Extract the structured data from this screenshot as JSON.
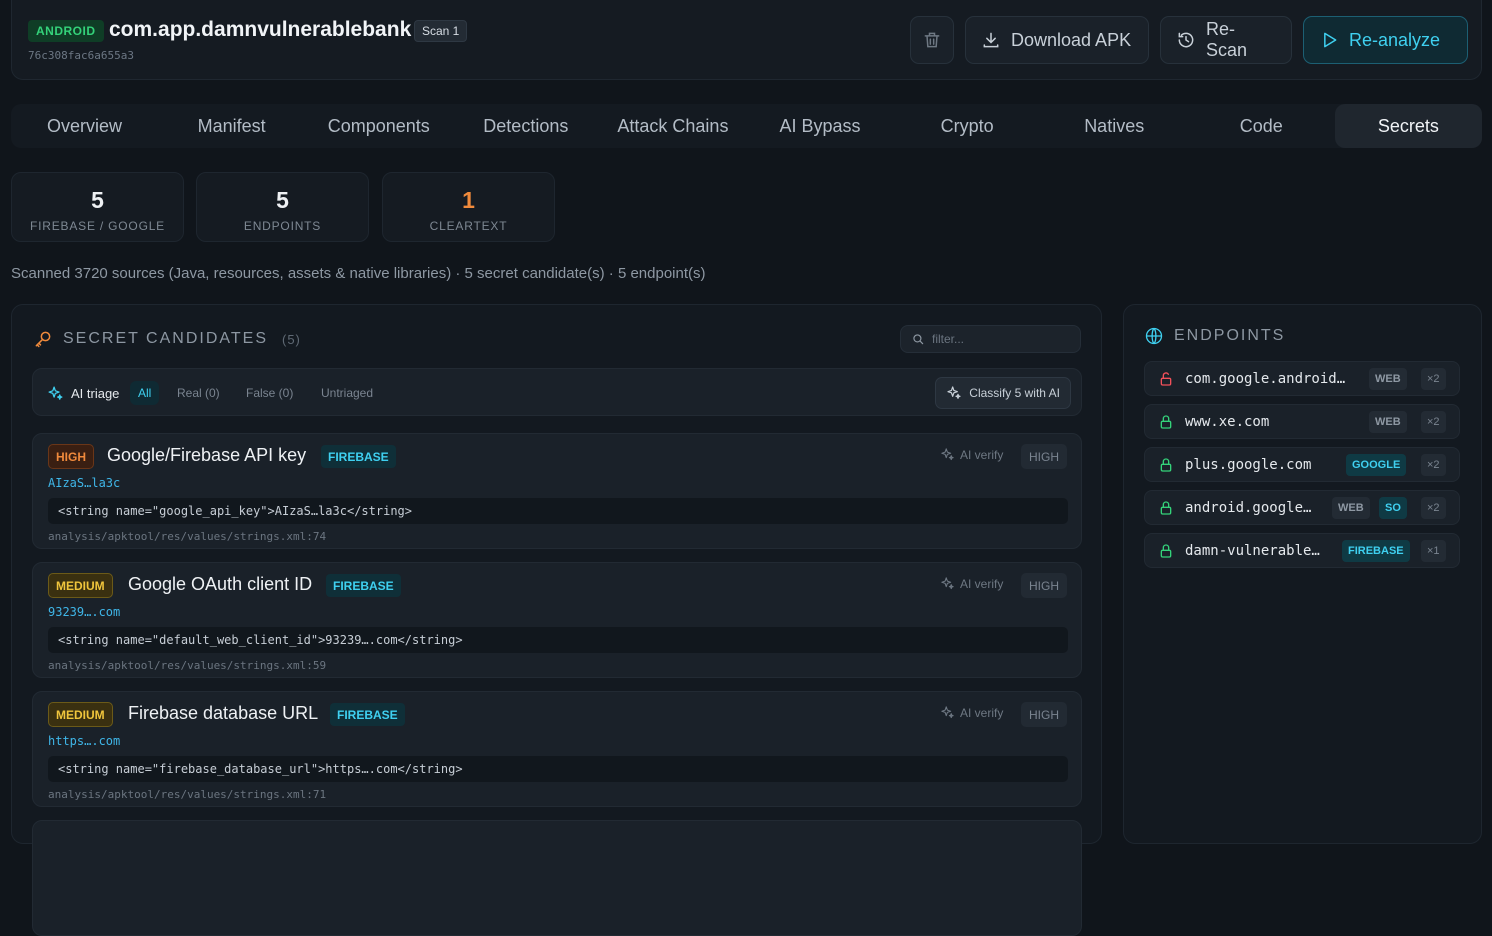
{
  "app": {
    "platform": "ANDROID",
    "package": "com.app.damnvulnerablebank",
    "scan": "Scan 1",
    "hash": "76c308fac6a655a3"
  },
  "header_buttons": {
    "download": "Download APK",
    "rescan": "Re-Scan",
    "reanalyze": "Re-analyze"
  },
  "tabs": [
    "Overview",
    "Manifest",
    "Components",
    "Detections",
    "Attack Chains",
    "AI Bypass",
    "Crypto",
    "Natives",
    "Code",
    "Secrets"
  ],
  "active_tab": "Secrets",
  "stats": [
    {
      "value": "5",
      "label": "FIREBASE / GOOGLE"
    },
    {
      "value": "5",
      "label": "ENDPOINTS"
    },
    {
      "value": "1",
      "label": "CLEARTEXT"
    }
  ],
  "summary": "Scanned 3720 sources (Java, resources, assets & native libraries) · 5 secret candidate(s) · 5 endpoint(s)",
  "secrets": {
    "title": "SECRET CANDIDATES",
    "count": "(5)",
    "filter_placeholder": "filter...",
    "triage_label": "AI triage",
    "pills": [
      "All",
      "Real (0)",
      "False (0)",
      "Untriaged"
    ],
    "classify_label": "Classify 5 with AI",
    "ai_verify": "AI verify",
    "cards": [
      {
        "severity": "HIGH",
        "title": "Google/Firebase API key",
        "tag": "FIREBASE",
        "value": "AIzaS…la3c",
        "code": "<string name=\"google_api_key\">AIzaS…la3c</string>",
        "path": "analysis/apktool/res/values/strings.xml:74",
        "confidence": "HIGH"
      },
      {
        "severity": "MEDIUM",
        "title": "Google OAuth client ID",
        "tag": "FIREBASE",
        "value": "93239….com",
        "code": "<string name=\"default_web_client_id\">93239….com</string>",
        "path": "analysis/apktool/res/values/strings.xml:59",
        "confidence": "HIGH"
      },
      {
        "severity": "MEDIUM",
        "title": "Firebase database URL",
        "tag": "FIREBASE",
        "value": "https….com",
        "code": "<string name=\"firebase_database_url\">https….com</string>",
        "path": "analysis/apktool/res/values/strings.xml:71",
        "confidence": "HIGH"
      }
    ]
  },
  "endpoints": {
    "title": "ENDPOINTS",
    "items": [
      {
        "host": "com.google.android…",
        "tags": [
          "WEB"
        ],
        "count": "×2",
        "secure": false
      },
      {
        "host": "www.xe.com",
        "tags": [
          "WEB"
        ],
        "count": "×2",
        "secure": true
      },
      {
        "host": "plus.google.com",
        "tags": [
          "GOOGLE"
        ],
        "count": "×2",
        "secure": true
      },
      {
        "host": "android.google…",
        "tags": [
          "WEB",
          "SO"
        ],
        "count": "×2",
        "secure": true
      },
      {
        "host": "damn-vulnerable…",
        "tags": [
          "FIREBASE"
        ],
        "count": "×1",
        "secure": true
      }
    ]
  },
  "colors": {
    "accent": "#3fd0f0",
    "high": "#f08a3c",
    "medium": "#f0c53c",
    "android": "#34d27a",
    "insecure": "#f0505a",
    "secure": "#34d27a"
  }
}
